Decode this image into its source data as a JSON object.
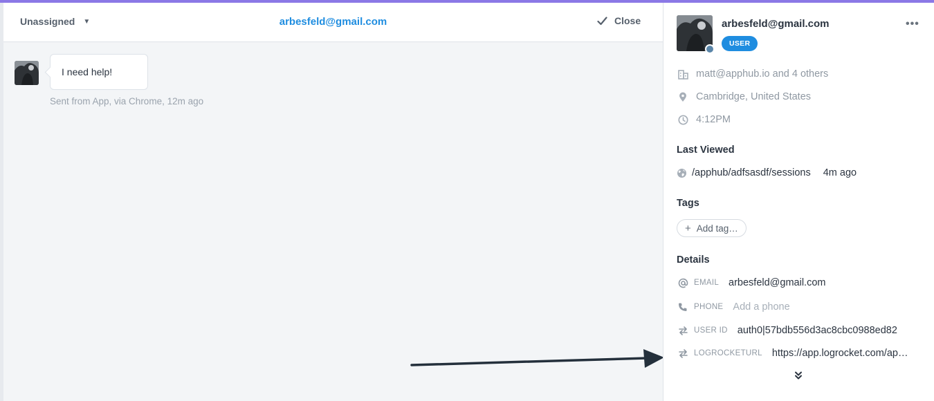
{
  "conversation": {
    "assignee": "Unassigned",
    "title": "arbesfeld@gmail.com",
    "close_label": "Close",
    "message": {
      "text": "I need help!",
      "meta": "Sent from App, via Chrome, 12m ago"
    }
  },
  "profile": {
    "name": "arbesfeld@gmail.com",
    "badge": "USER",
    "company": "matt@apphub.io and 4 others",
    "location": "Cambridge, United States",
    "local_time": "4:12PM",
    "last_viewed_title": "Last Viewed",
    "last_viewed_path": "/apphub/adfsasdf/sessions",
    "last_viewed_time": "4m ago",
    "tags_title": "Tags",
    "add_tag": "Add tag…",
    "details_title": "Details",
    "details": [
      {
        "label": "EMAIL",
        "value": "arbesfeld@gmail.com",
        "icon": "at-icon"
      },
      {
        "label": "PHONE",
        "value": "Add a phone",
        "icon": "phone-icon"
      },
      {
        "label": "USER ID",
        "value": "auth0|57bdb556d3ac8cbc0988ed82",
        "icon": "swap-icon"
      },
      {
        "label": "LOGROCKETURL",
        "value": "https://app.logrocket.com/ap…",
        "icon": "swap-icon"
      }
    ]
  },
  "colors": {
    "accent_bar": "#8b78e6",
    "link_blue": "#1f8de0",
    "badge_blue": "#1f8de0",
    "annotation_arrow": "#24303c"
  }
}
